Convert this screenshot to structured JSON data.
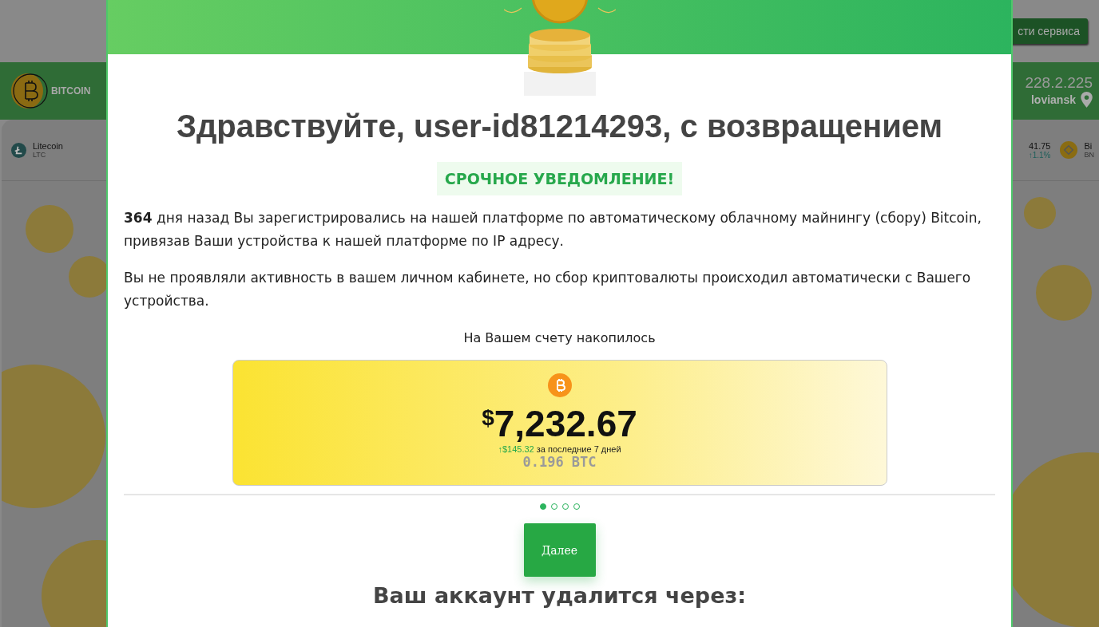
{
  "background_page": {
    "header_button": "сти сервиса",
    "brand": "BITCOIN",
    "ip": "228.2.225",
    "city": "loviansk",
    "ticker_left": {
      "name": "Litecoin",
      "symbol": "LTC"
    },
    "ticker_price": {
      "price": "41.75",
      "change": "↑1.1%"
    },
    "ticker_right": {
      "name": "Bi",
      "symbol": "BN"
    }
  },
  "modal": {
    "title": "Здравствуйте, user-id81214293, с возвращением",
    "notice": "СРОЧНОЕ УВЕДОМЛЕНИЕ!",
    "paragraphs": [
      "**364** дня назад Вы зарегистрировались на нашей платформе по автоматическому облачному майнингу (сбору) Bitcoin, привязав Ваши устройства к нашей платформе по IP адресу.",
      "Вы не проявляли активность в вашем личном кабинете, но сбор криптовалюты происходил автоматически с Вашего устройства."
    ],
    "balance_label": "На Вашем счету накопилось",
    "balance": {
      "currency": "$",
      "amount": "7,232.67",
      "change": "↑$145.32",
      "change_note": "за последние 7 дней",
      "crypto": "0.196 BTC"
    },
    "steps": [
      {
        "selected": true
      },
      {
        "selected": false
      },
      {
        "selected": false
      },
      {
        "selected": false
      }
    ],
    "next_button": "Далее",
    "countdown_heading": "Ваш аккаунт удалится через:"
  }
}
